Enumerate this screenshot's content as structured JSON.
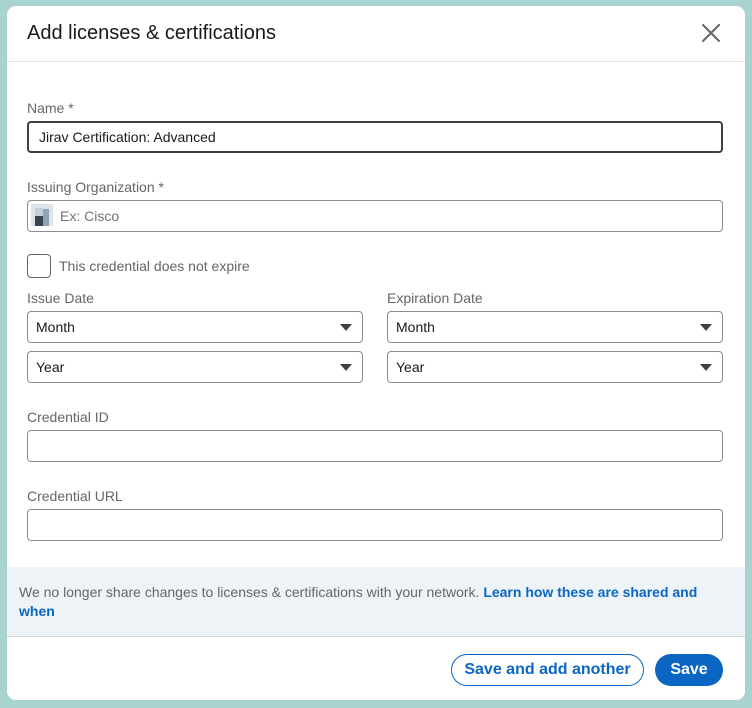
{
  "modal": {
    "title": "Add licenses & certifications",
    "close_icon": "close-icon"
  },
  "form": {
    "name": {
      "label": "Name *",
      "value": "Jirav Certification: Advanced"
    },
    "issuing_org": {
      "label": "Issuing Organization *",
      "placeholder": "Ex: Cisco",
      "icon": "company-logo-icon"
    },
    "no_expire": {
      "label": "This credential does not expire",
      "checked": false
    },
    "issue_date": {
      "label": "Issue Date",
      "month": "Month",
      "year": "Year"
    },
    "expiration_date": {
      "label": "Expiration Date",
      "month": "Month",
      "year": "Year"
    },
    "credential_id": {
      "label": "Credential ID",
      "value": ""
    },
    "credential_url": {
      "label": "Credential URL",
      "value": ""
    }
  },
  "notice": {
    "text": "We no longer share changes to licenses & certifications with your network.",
    "link": "Learn how these are shared and when"
  },
  "footer": {
    "save_and_add": "Save and add another",
    "save": "Save"
  },
  "colors": {
    "accent": "#0a66c2",
    "notice_bg": "#eef3f8",
    "backdrop": "#a9d3cf"
  }
}
